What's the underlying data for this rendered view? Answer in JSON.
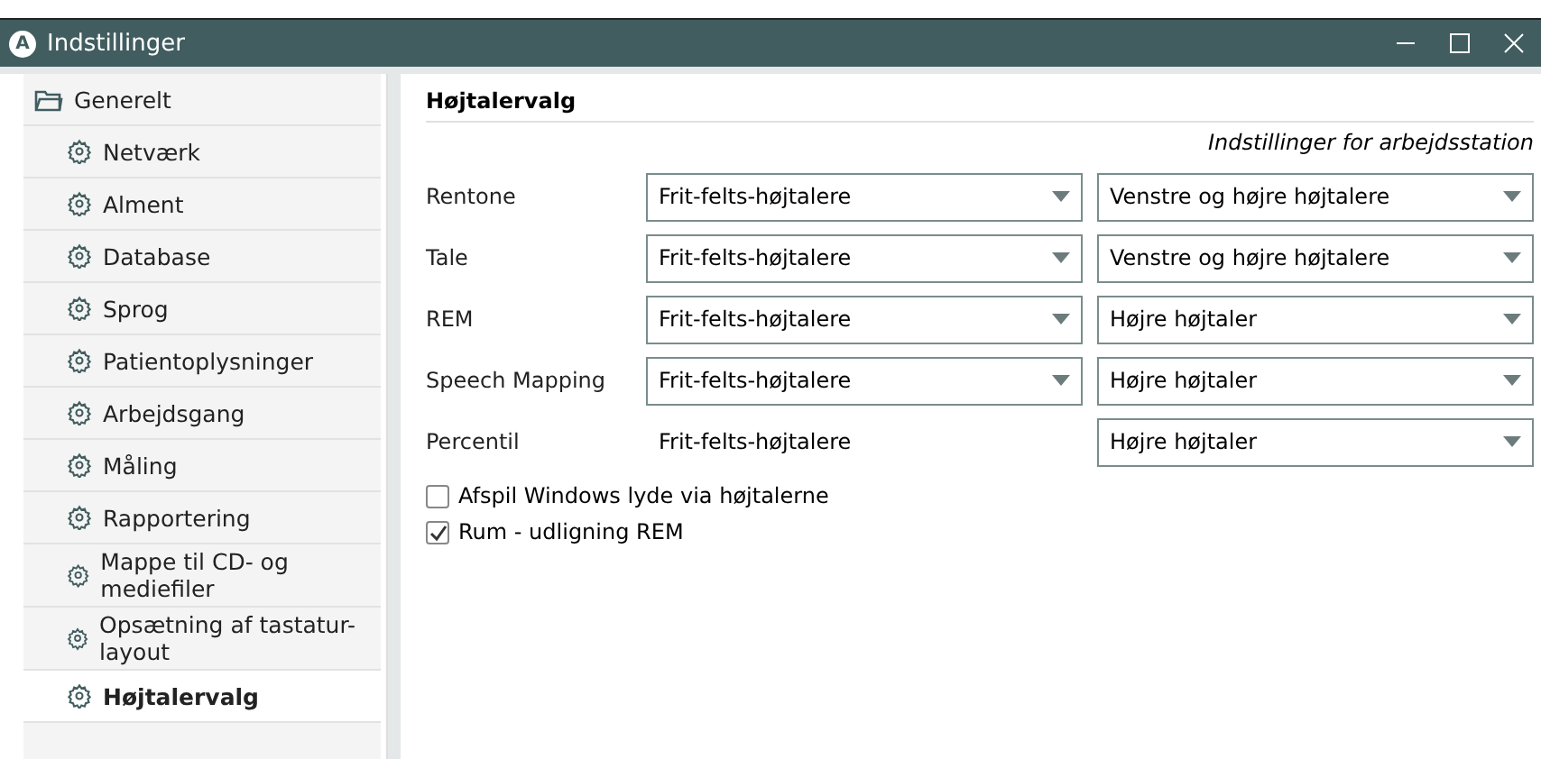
{
  "window": {
    "title": "Indstillinger",
    "app_letter": "A"
  },
  "sidebar": {
    "items": [
      {
        "label": "Generelt",
        "kind": "folder",
        "selected": false
      },
      {
        "label": "Netværk",
        "kind": "setting",
        "selected": false
      },
      {
        "label": "Alment",
        "kind": "setting",
        "selected": false
      },
      {
        "label": "Database",
        "kind": "setting",
        "selected": false
      },
      {
        "label": "Sprog",
        "kind": "setting",
        "selected": false
      },
      {
        "label": "Patientoplysninger",
        "kind": "setting",
        "selected": false
      },
      {
        "label": "Arbejdsgang",
        "kind": "setting",
        "selected": false
      },
      {
        "label": "Måling",
        "kind": "setting",
        "selected": false
      },
      {
        "label": "Rapportering",
        "kind": "setting",
        "selected": false
      },
      {
        "label": "Mappe til CD- og mediefiler",
        "kind": "setting",
        "selected": false
      },
      {
        "label": "Opsætning af tastatur-layout",
        "kind": "setting",
        "selected": false
      },
      {
        "label": "Højtalervalg",
        "kind": "setting",
        "selected": true
      }
    ]
  },
  "panel": {
    "title": "Højtalervalg",
    "subtitle": "Indstillinger for arbejdsstation",
    "rows": [
      {
        "label": "Rentone",
        "output": {
          "kind": "dropdown",
          "value": "Frit-felts-højtalere"
        },
        "side": "Venstre og højre højtalere"
      },
      {
        "label": "Tale",
        "output": {
          "kind": "dropdown",
          "value": "Frit-felts-højtalere"
        },
        "side": "Venstre og højre højtalere"
      },
      {
        "label": "REM",
        "output": {
          "kind": "dropdown",
          "value": "Frit-felts-højtalere"
        },
        "side": "Højre højtaler"
      },
      {
        "label": "Speech Mapping",
        "output": {
          "kind": "dropdown",
          "value": "Frit-felts-højtalere"
        },
        "side": "Højre højtaler"
      },
      {
        "label": "Percentil",
        "output": {
          "kind": "text",
          "value": "Frit-felts-højtalere"
        },
        "side": "Højre højtaler"
      }
    ],
    "checkboxes": [
      {
        "label": "Afspil Windows lyde via højtalerne",
        "checked": false
      },
      {
        "label": "Rum - udligning REM",
        "checked": true
      }
    ]
  }
}
